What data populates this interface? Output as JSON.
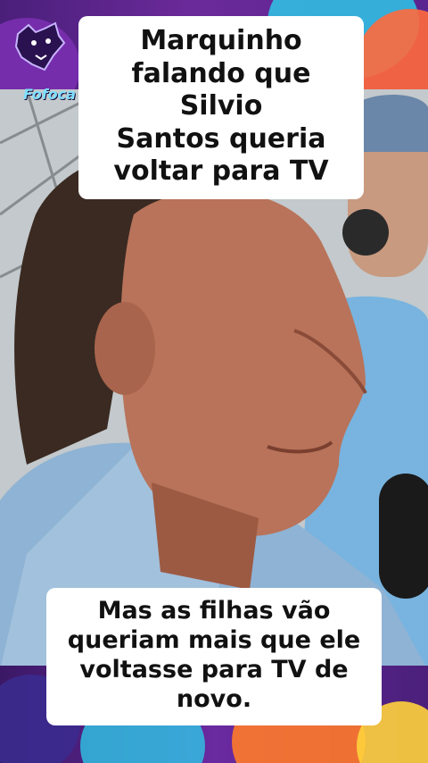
{
  "brand": {
    "name": "Fofoca",
    "icon": "bear-head-icon"
  },
  "captions": {
    "top": [
      "Marquinho",
      "falando que Silvio",
      "Santos queria",
      "voltar para TV"
    ],
    "bottom": [
      "Mas as filhas vão",
      "queriam mais que ele",
      "voltasse para TV de",
      "novo."
    ]
  },
  "colors": {
    "band": "#5a2590",
    "caption_bg": "#ffffff",
    "caption_text": "#111111",
    "logo_text": "#7fe0ff"
  }
}
